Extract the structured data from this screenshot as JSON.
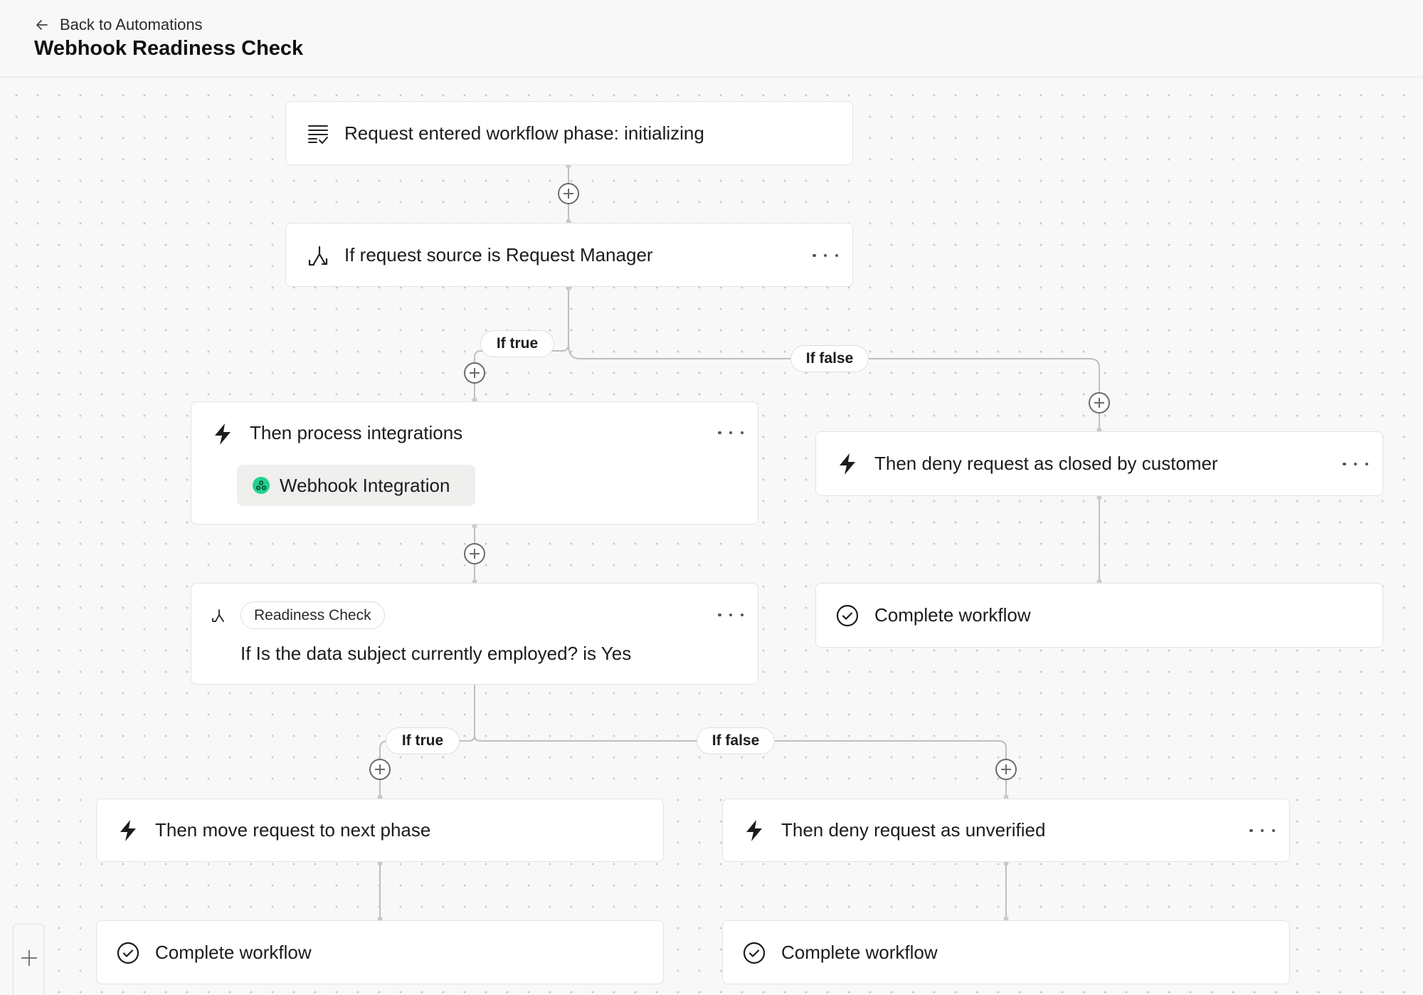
{
  "header": {
    "back_label": "Back to Automations",
    "title": "Webhook Readiness Check"
  },
  "nodes": {
    "trigger": {
      "label": "Request entered workflow phase: initializing",
      "icon": "list-check-icon"
    },
    "condition1": {
      "label": "If request source is Request Manager",
      "icon": "branch-icon"
    },
    "process": {
      "label": "Then process integrations",
      "icon": "lightning-icon",
      "integration": "Webhook Integration"
    },
    "deny_closed": {
      "label": "Then deny request as closed by customer",
      "icon": "lightning-icon"
    },
    "complete_a": {
      "label": "Complete workflow",
      "icon": "check-circle-icon"
    },
    "readiness": {
      "badge": "Readiness Check",
      "label": "If Is the data subject currently employed? is Yes",
      "icon": "branch-icon"
    },
    "move_next": {
      "label": "Then move request to next phase",
      "icon": "lightning-icon"
    },
    "deny_unverified": {
      "label": "Then deny request as unverified",
      "icon": "lightning-icon"
    },
    "complete_b": {
      "label": "Complete workflow",
      "icon": "check-circle-icon"
    },
    "complete_c": {
      "label": "Complete workflow",
      "icon": "check-circle-icon"
    }
  },
  "branches": {
    "b1_true": "If true",
    "b1_false": "If false",
    "b2_true": "If true",
    "b2_false": "If false"
  },
  "colors": {
    "integration_dot": "#1ed38f",
    "connector": "#bdbfbd"
  }
}
